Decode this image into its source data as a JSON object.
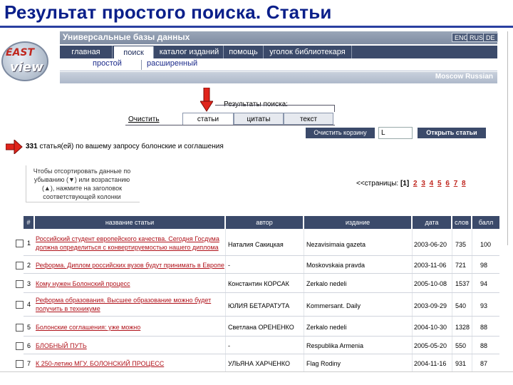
{
  "slide": {
    "title": "Результат простого поиска. Статьи"
  },
  "header": {
    "logo_line1": "EAST",
    "logo_line2": "view",
    "db_title": "Универсальные базы данных",
    "langs": [
      "ENG",
      "RUS",
      "DE"
    ]
  },
  "nav": {
    "items": [
      "главная",
      "поиск",
      "каталог изданий",
      "помощь",
      "уголок библиотекаря"
    ],
    "active": "поиск"
  },
  "subnav": {
    "items": [
      "простой",
      "расширенный"
    ]
  },
  "region": {
    "label": "Moscow Russian"
  },
  "results": {
    "heading": "Результаты поиска:",
    "check_all": "Очистить",
    "tabs": [
      "статьи",
      "цитаты",
      "текст"
    ],
    "active_tab": "статьи",
    "clear_basket": "Очистить корзину",
    "basket_value": "L",
    "open_articles": "Открыть статьи",
    "found_count": "331",
    "found_text": "статья(ей) по вашему запросу болонские и соглашения",
    "hint": "Чтобы отсортировать данные по убыванию (▼) или возрастанию (▲), нажмите на заголовок соответствующей колонки",
    "pager_label": "<<страницы:",
    "pager_current": "[1]",
    "pages": [
      "2",
      "3",
      "4",
      "5",
      "6",
      "7",
      "8"
    ]
  },
  "table": {
    "columns": [
      "#",
      "название статьи",
      "автор",
      "издание",
      "дата",
      "слов",
      "балл"
    ],
    "rows": [
      {
        "num": "1",
        "title_lines": [
          "Российский студент европейского качества. Сегодня Госдума",
          "должна определиться с конвертируемостью нашего диплома"
        ],
        "author": "Наталия Сакицкая",
        "source": "Nezavisimaia gazeta",
        "date": "2003-06-20",
        "words": "735",
        "score": "100"
      },
      {
        "num": "2",
        "title_lines": [
          "Реформа. Диплом российских вузов будут принимать в Европе"
        ],
        "author": "-",
        "source": "Moskovskaia pravda",
        "date": "2003-11-06",
        "words": "721",
        "score": "98"
      },
      {
        "num": "3",
        "title_lines": [
          "Кому нужен Болонский процесс"
        ],
        "author": "Константин КОРСАК",
        "source": "Zerkalo nedeli",
        "date": "2005-10-08",
        "words": "1537",
        "score": "94"
      },
      {
        "num": "4",
        "title_lines": [
          "Реформа образования. Высшее образование можно будет",
          "получить в техникуме"
        ],
        "author": "ЮЛИЯ БЕТАРАТУТА",
        "source": "Kommersant. Daily",
        "date": "2003-09-29",
        "words": "540",
        "score": "93"
      },
      {
        "num": "5",
        "title_lines": [
          "Болонские соглашения: уже можно"
        ],
        "author": "Светлана ОРЕНЕНКО",
        "source": "Zerkalo nedeli",
        "date": "2004-10-30",
        "words": "1328",
        "score": "88"
      },
      {
        "num": "6",
        "title_lines": [
          "БЛОБНЫЙ ПУТЬ"
        ],
        "author": "-",
        "source": "Respublika Armenia",
        "date": "2005-05-20",
        "words": "550",
        "score": "88"
      },
      {
        "num": "7",
        "title_lines": [
          "К 250-летию МГУ. БОЛОНСКИЙ ПРОЦЕСС"
        ],
        "author": "УЛЬЯНА ХАРЧЕНКО",
        "source": "Flag Rodiny",
        "date": "2004-11-16",
        "words": "931",
        "score": "87"
      }
    ]
  },
  "colors": {
    "title": "#0a1f8a",
    "nav": "#3b4a6a",
    "link": "#b0121a",
    "arrow": "#e0241b"
  },
  "icons": [
    "arrow-down-icon",
    "arrow-right-icon",
    "checkbox-icon"
  ]
}
